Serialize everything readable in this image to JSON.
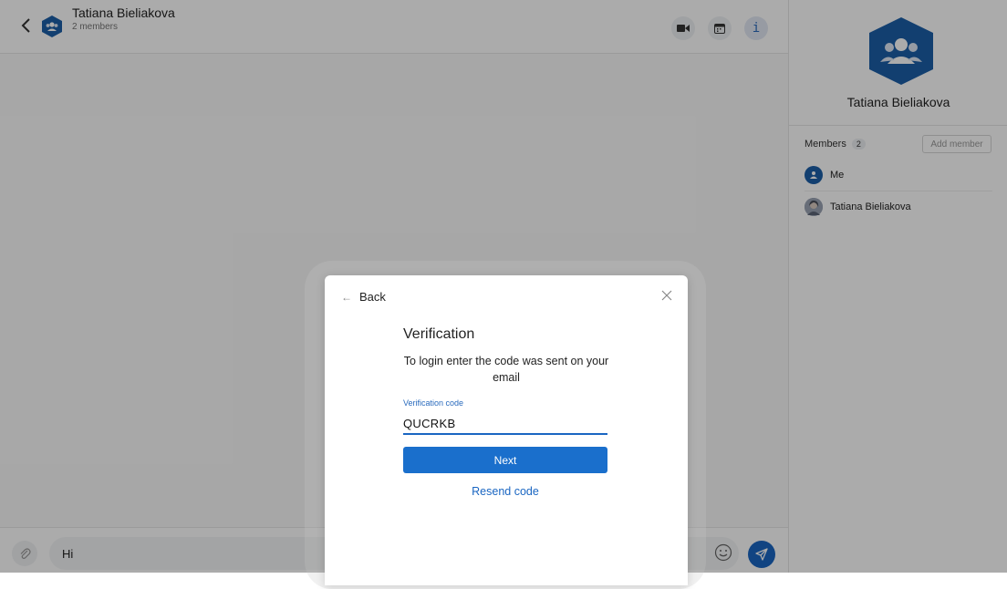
{
  "chat": {
    "title": "Tatiana Bieliakova",
    "subtitle": "2 members",
    "message_value": "Hi",
    "icons": {
      "back": "chevron-left-icon",
      "video": "video-camera-icon",
      "calendar": "calendar-icon",
      "info_glyph": "i",
      "attach": "paperclip-icon",
      "emoji": "smiley-icon",
      "send": "paper-plane-icon"
    }
  },
  "sidebar": {
    "name": "Tatiana Bieliakova",
    "members_label": "Members",
    "members_count": "2",
    "add_member_label": "Add member",
    "members": [
      {
        "name": "Me"
      },
      {
        "name": "Tatiana Bieliakova"
      }
    ]
  },
  "modal": {
    "back_label": "Back",
    "title": "Verification",
    "description": "To login enter the code was sent on your email",
    "field_label": "Verification code",
    "field_value": "QUCRKB",
    "next_label": "Next",
    "resend_label": "Resend code"
  },
  "colors": {
    "accent": "#1a66c2",
    "brand_avatar": "#1c5fa8",
    "overlay": "rgba(0,0,0,0.33)"
  }
}
